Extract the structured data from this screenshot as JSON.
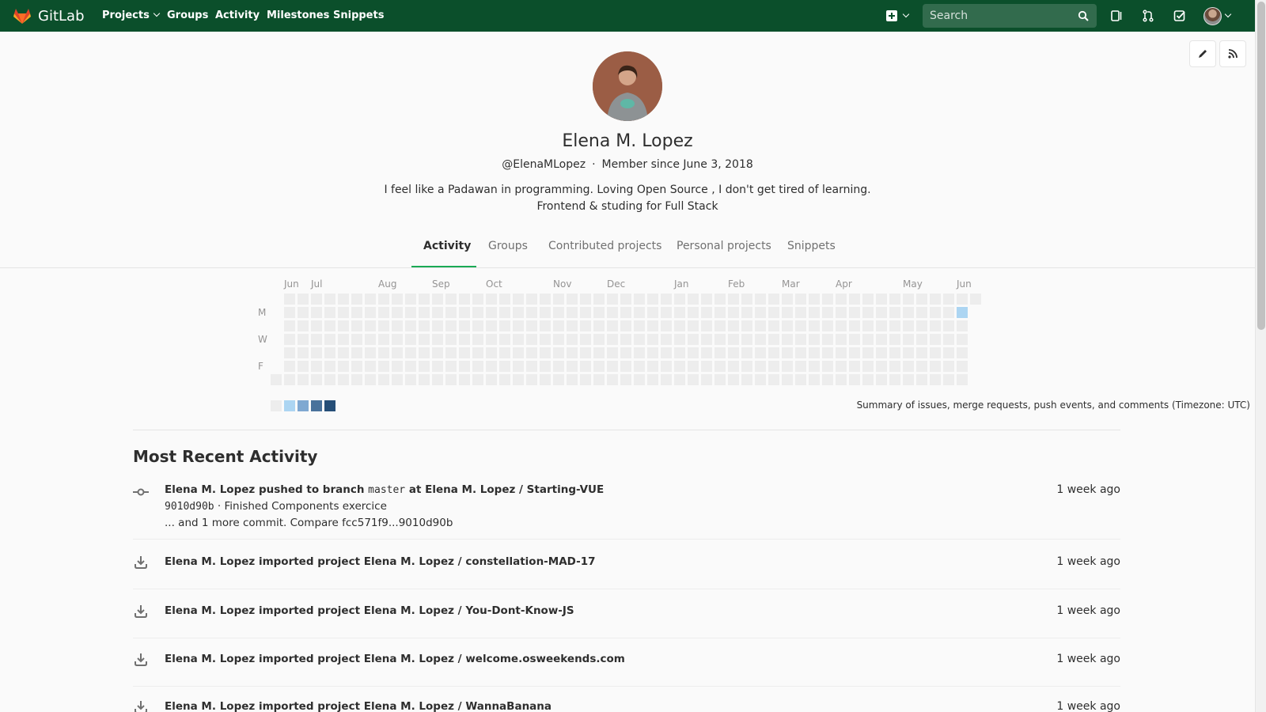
{
  "navbar": {
    "brand": "GitLab",
    "links": [
      {
        "label": "Projects",
        "dropdown": true
      },
      {
        "label": "Groups"
      },
      {
        "label": "Activity"
      },
      {
        "label": "Milestones"
      },
      {
        "label": "Snippets"
      }
    ],
    "search_placeholder": "Search",
    "icons": [
      "plus-square-icon",
      "search-icon",
      "issues-icon",
      "merge-request-icon",
      "todo-icon",
      "user-avatar"
    ],
    "background": "#0b4f2b"
  },
  "profile": {
    "name": "Elena M. Lopez",
    "username": "@ElenaMLopez",
    "member_since": "Member since June 3, 2018",
    "bio_line1": "I feel like a Padawan in programming. Loving Open Source , I don't get tired of learning.",
    "bio_line2": "Frontend & studing for Full Stack"
  },
  "tabs": [
    {
      "label": "Activity",
      "active": true
    },
    {
      "label": "Groups"
    },
    {
      "label": "Contributed projects"
    },
    {
      "label": "Personal projects"
    },
    {
      "label": "Snippets"
    }
  ],
  "calendar": {
    "months": [
      "Jun",
      "Jul",
      "Aug",
      "Sep",
      "Oct",
      "Nov",
      "Dec",
      "Jan",
      "Feb",
      "Mar",
      "Apr",
      "May",
      "Jun"
    ],
    "day_labels": [
      "M",
      "W",
      "F"
    ],
    "active_cells": [
      {
        "week": 51,
        "day": 1,
        "level": 1
      }
    ],
    "legend_colors": [
      "#ededed",
      "#acd5f2",
      "#7fa8d1",
      "#49729b",
      "#254e77"
    ],
    "summary": "Summary of issues, merge requests, push events, and comments (Timezone: UTC)"
  },
  "activity": {
    "title": "Most Recent Activity",
    "events": [
      {
        "icon": "commit-icon",
        "title_prefix": "Elena M. Lopez pushed to branch",
        "branch": "master",
        "title_suffix": "at Elena M. Lopez / Starting-VUE",
        "commit_sha": "9010d90b",
        "commit_msg": " · Finished Components exercice",
        "more": "... and 1 more commit. Compare fcc571f9...9010d90b",
        "time": "1 week ago"
      },
      {
        "icon": "import-icon",
        "title": "Elena M. Lopez imported project Elena M. Lopez / constellation-MAD-17",
        "time": "1 week ago"
      },
      {
        "icon": "import-icon",
        "title": "Elena M. Lopez imported project Elena M. Lopez / You-Dont-Know-JS",
        "time": "1 week ago"
      },
      {
        "icon": "import-icon",
        "title": "Elena M. Lopez imported project Elena M. Lopez / welcome.osweekends.com",
        "time": "1 week ago"
      },
      {
        "icon": "import-icon",
        "title": "Elena M. Lopez imported project Elena M. Lopez / WannaBanana",
        "time": "1 week ago"
      }
    ]
  },
  "header_actions": [
    "edit-profile-button",
    "rss-feed-button"
  ]
}
